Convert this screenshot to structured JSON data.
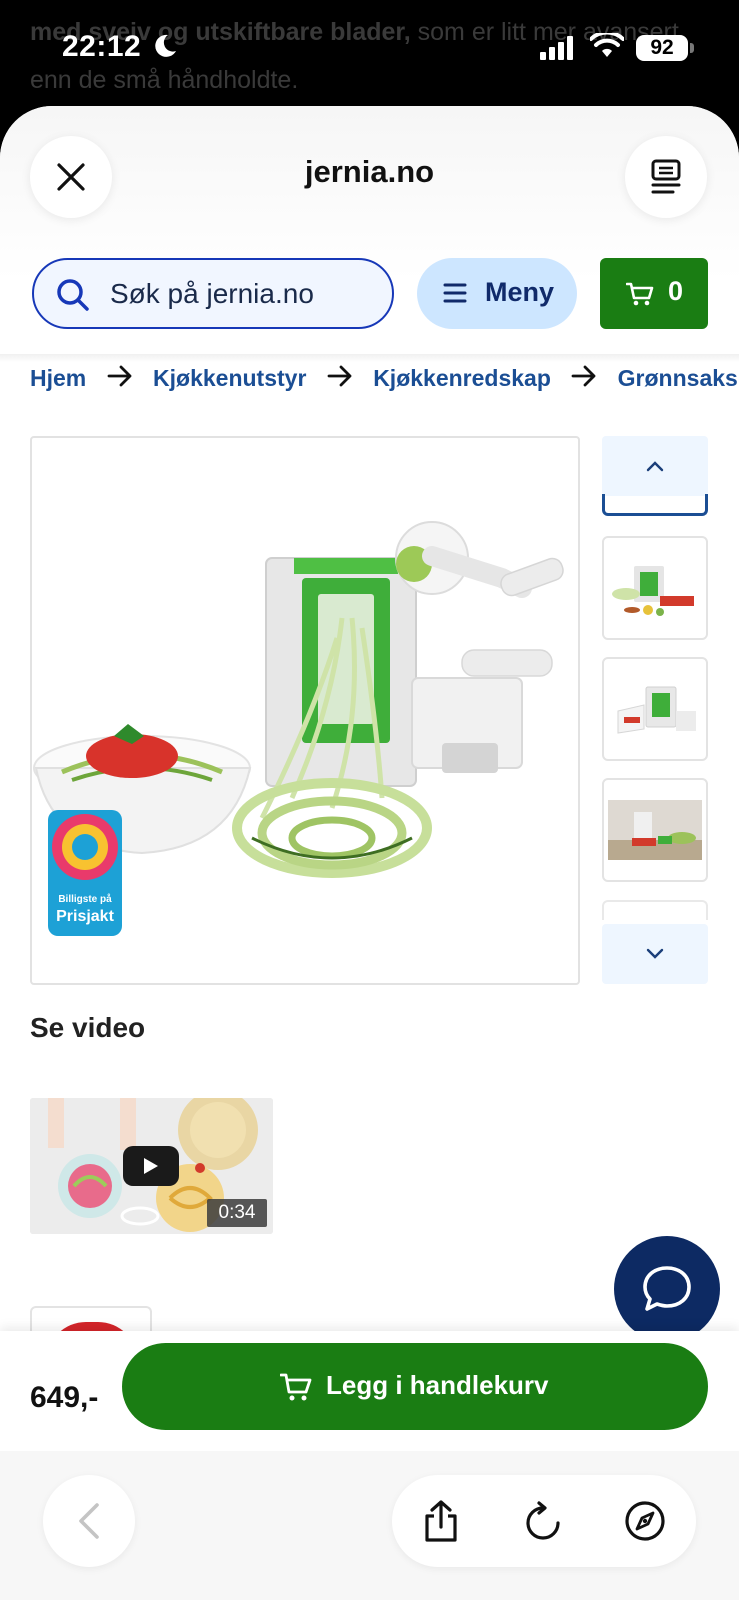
{
  "status_bar": {
    "time": "22:12",
    "battery": "92",
    "background_text_bold": "med sveiv og utskiftbare blader,",
    "background_text_rest": " som er litt mer avansert enn de små håndholdte."
  },
  "header": {
    "site_title": "jernia.no",
    "close_icon": "close-icon",
    "reader_icon": "reader-view-icon"
  },
  "search": {
    "placeholder": "Søk på jernia.no"
  },
  "menu": {
    "label": "Meny"
  },
  "cart": {
    "count": "0"
  },
  "breadcrumb": {
    "items": [
      "Hjem",
      "Kjøkkenutstyr",
      "Kjøkkenredskap",
      "Grønnsaksk"
    ]
  },
  "badge": {
    "small": "Billigste på",
    "big": "Prisjakt"
  },
  "video": {
    "title": "Se video",
    "duration": "0:34"
  },
  "bottom": {
    "price": "649,-",
    "add_to_cart": "Legg i handlekurv"
  },
  "colors": {
    "brand_green": "#1a7d13",
    "brand_blue": "#1b4e94",
    "dark_navy": "#0d2a63",
    "menu_bg": "#cde6ff"
  }
}
